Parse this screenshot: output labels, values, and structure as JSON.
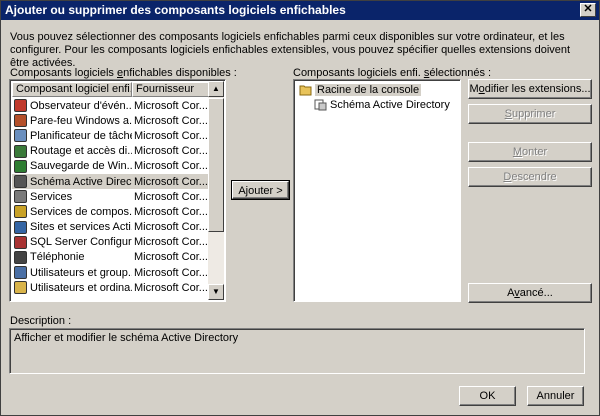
{
  "window": {
    "title": "Ajouter ou supprimer des composants logiciels enfichables",
    "close_glyph": "✕"
  },
  "intro": "Vous pouvez sélectionner des composants logiciels enfichables parmi ceux disponibles sur votre ordinateur, et les configurer. Pour les composants logiciels enfichables extensibles, vous pouvez spécifier quelles extensions doivent être activées.",
  "available": {
    "label_pre": "Composants logiciels ",
    "label_u": "e",
    "label_post": "nfichables disponibles :",
    "columns": [
      "Composant logiciel enfi...",
      "Fournisseur"
    ],
    "items": [
      {
        "name": "Observateur d'évén...",
        "provider": "Microsoft Cor...",
        "icon": "event-viewer-icon",
        "color": "#c0392b"
      },
      {
        "name": "Pare-feu Windows a...",
        "provider": "Microsoft Cor...",
        "icon": "firewall-icon",
        "color": "#b5502a"
      },
      {
        "name": "Planificateur de tâches",
        "provider": "Microsoft Cor...",
        "icon": "task-scheduler-icon",
        "color": "#6a8fbf"
      },
      {
        "name": "Routage et accès di...",
        "provider": "Microsoft Cor...",
        "icon": "routing-icon",
        "color": "#3a7a3a"
      },
      {
        "name": "Sauvegarde de Win...",
        "provider": "Microsoft Cor...",
        "icon": "backup-icon",
        "color": "#2e7d32"
      },
      {
        "name": "Schéma Active Direc...",
        "provider": "Microsoft Cor...",
        "icon": "schema-icon",
        "color": "#555555"
      },
      {
        "name": "Services",
        "provider": "Microsoft Cor...",
        "icon": "services-icon",
        "color": "#7a7a7a"
      },
      {
        "name": "Services de compos...",
        "provider": "Microsoft Cor...",
        "icon": "component-services-icon",
        "color": "#c9a227"
      },
      {
        "name": "Sites et services Acti...",
        "provider": "Microsoft Cor...",
        "icon": "sites-icon",
        "color": "#3465a4"
      },
      {
        "name": "SQL Server Configur...",
        "provider": "Microsoft Cor...",
        "icon": "sql-icon",
        "color": "#a83232"
      },
      {
        "name": "Téléphonie",
        "provider": "Microsoft Cor...",
        "icon": "telephony-icon",
        "color": "#444444"
      },
      {
        "name": "Utilisateurs et group...",
        "provider": "Microsoft Cor...",
        "icon": "users-icon",
        "color": "#4a6fa5"
      },
      {
        "name": "Utilisateurs et ordina...",
        "provider": "Microsoft Cor...",
        "icon": "users-computers-icon",
        "color": "#d9b44a"
      }
    ],
    "selected_index": 5
  },
  "add_button": {
    "pre": "A",
    "u": "j",
    "post": "outer >"
  },
  "selected": {
    "label_pre": "Composants logiciels enfi. ",
    "label_u": "s",
    "label_post": "électionnés :",
    "root": "Racine de la console",
    "child": "Schéma Active Directory"
  },
  "buttons": {
    "edit_ext": {
      "pre": "M",
      "u": "o",
      "post": "difier les extensions..."
    },
    "remove": {
      "pre": "",
      "u": "S",
      "post": "upprimer"
    },
    "up": {
      "pre": "",
      "u": "M",
      "post": "onter"
    },
    "down": {
      "pre": "",
      "u": "D",
      "post": "escendre"
    },
    "advanced": {
      "pre": "A",
      "u": "v",
      "post": "ancé..."
    },
    "ok": "OK",
    "cancel": "Annuler"
  },
  "description": {
    "label": "Description :",
    "text": "Afficher et modifier le schéma Active Directory"
  }
}
